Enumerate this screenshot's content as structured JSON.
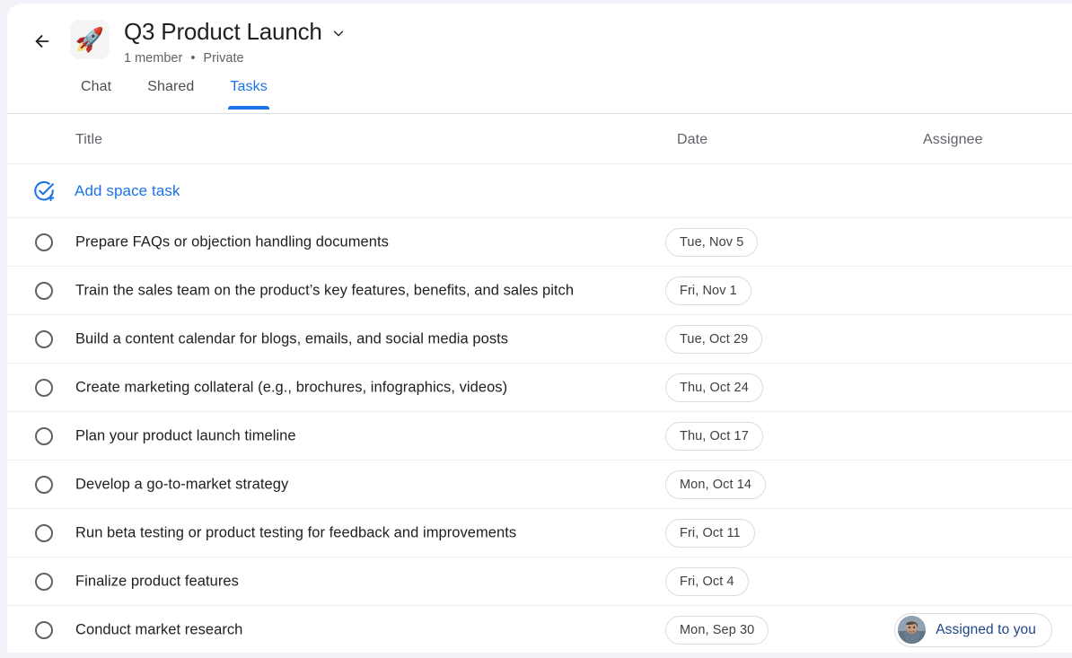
{
  "header": {
    "back_icon": "arrow-left-icon",
    "space_emoji": "🚀",
    "title": "Q3 Product Launch",
    "title_chevron_icon": "chevron-down-icon",
    "member_count": "1 member",
    "separator": "•",
    "visibility": "Private"
  },
  "tabs": [
    {
      "label": "Chat",
      "active": false
    },
    {
      "label": "Shared",
      "active": false
    },
    {
      "label": "Tasks",
      "active": true
    }
  ],
  "table": {
    "columns": {
      "title": "Title",
      "date": "Date",
      "assignee": "Assignee"
    },
    "add_task": {
      "icon": "add-task-check-icon",
      "label": "Add space task"
    },
    "rows": [
      {
        "title": "Prepare FAQs or objection handling documents",
        "date": "Tue, Nov 5",
        "assignee": ""
      },
      {
        "title": "Train the sales team on the product’s key features, benefits, and sales pitch",
        "date": "Fri, Nov 1",
        "assignee": ""
      },
      {
        "title": "Build a content calendar for blogs, emails, and social media posts",
        "date": "Tue, Oct 29",
        "assignee": ""
      },
      {
        "title": "Create marketing collateral (e.g., brochures, infographics, videos)",
        "date": "Thu, Oct 24",
        "assignee": ""
      },
      {
        "title": "Plan your product launch timeline",
        "date": "Thu, Oct 17",
        "assignee": ""
      },
      {
        "title": "Develop a go-to-market strategy",
        "date": "Mon, Oct 14",
        "assignee": ""
      },
      {
        "title": "Run beta testing or product testing for feedback and improvements",
        "date": "Fri, Oct 11",
        "assignee": ""
      },
      {
        "title": "Finalize product features",
        "date": "Fri, Oct 4",
        "assignee": ""
      },
      {
        "title": "Conduct market research",
        "date": "Mon, Sep 30",
        "assignee": "Assigned to you"
      }
    ]
  },
  "colors": {
    "accent_blue": "#1a73e8",
    "assignee_text": "#1c4587",
    "text_primary": "#202124",
    "text_secondary": "#5f6368",
    "divider": "#eceef0",
    "page_background": "#f1f3f8"
  }
}
